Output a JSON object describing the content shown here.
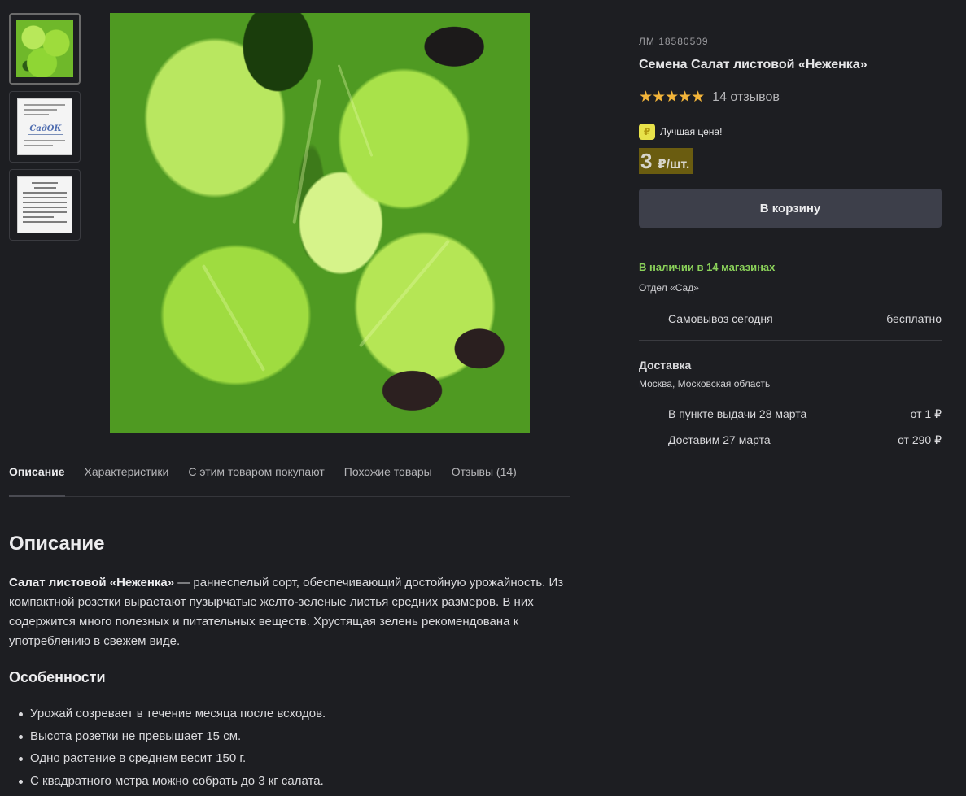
{
  "gallery": {
    "thumbnails": [
      {
        "name": "lettuce-photo",
        "alt": "Салат листовой"
      },
      {
        "name": "seed-pack-front",
        "logo": "СадОК"
      },
      {
        "name": "seed-pack-back",
        "alt": "Салат листовой «Неженка»"
      }
    ]
  },
  "product": {
    "sku": "ЛМ 18580509",
    "title": "Семена Салат листовой «Неженка»",
    "stars": "★★★★★",
    "rating": 5,
    "reviews": "14 отзывов",
    "best_price_label": "Лучшая цена!",
    "best_price_icon": "coin-icon",
    "price": "3",
    "price_unit": "₽/шт.",
    "cart_button": "В корзину"
  },
  "availability": {
    "stock": "В наличии в 14 магазинах",
    "department": "Отдел «Сад»",
    "pickup": {
      "label": "Самовывоз сегодня",
      "value": "бесплатно"
    }
  },
  "delivery": {
    "title": "Доставка",
    "region": "Москва, Московская область",
    "options": [
      {
        "label": "В пункте выдачи 28 марта",
        "value": "от 1 ₽"
      },
      {
        "label": "Доставим 27 марта",
        "value": "от 290 ₽"
      }
    ]
  },
  "tabs": [
    {
      "label": "Описание",
      "active": true
    },
    {
      "label": "Характеристики"
    },
    {
      "label": "С этим товаром покупают"
    },
    {
      "label": "Похожие товары"
    },
    {
      "label": "Отзывы (14)"
    }
  ],
  "description": {
    "heading": "Описание",
    "lead_bold": "Салат листовой «Неженка»",
    "lead_text": " — раннеспелый сорт, обеспечивающий достойную урожайность. Из компактной розетки вырастают пузырчатые желто-зеленые листья средних размеров. В них содержится много полезных и питательных веществ. Хрустящая зелень рекомендована к употреблению в свежем виде.",
    "features_heading": "Особенности",
    "features": [
      "Урожай созревает в течение месяца после всходов.",
      "Высота розетки не превышает 15 см.",
      "Одно растение в среднем весит 150 г.",
      "С квадратного метра можно собрать до 3 кг салата."
    ]
  },
  "colors": {
    "background": "#1d1e22",
    "star": "#f2b43a",
    "stock_green": "#8bd25a",
    "price_highlight": "#6a5c10",
    "button": "#3d3f4a"
  }
}
